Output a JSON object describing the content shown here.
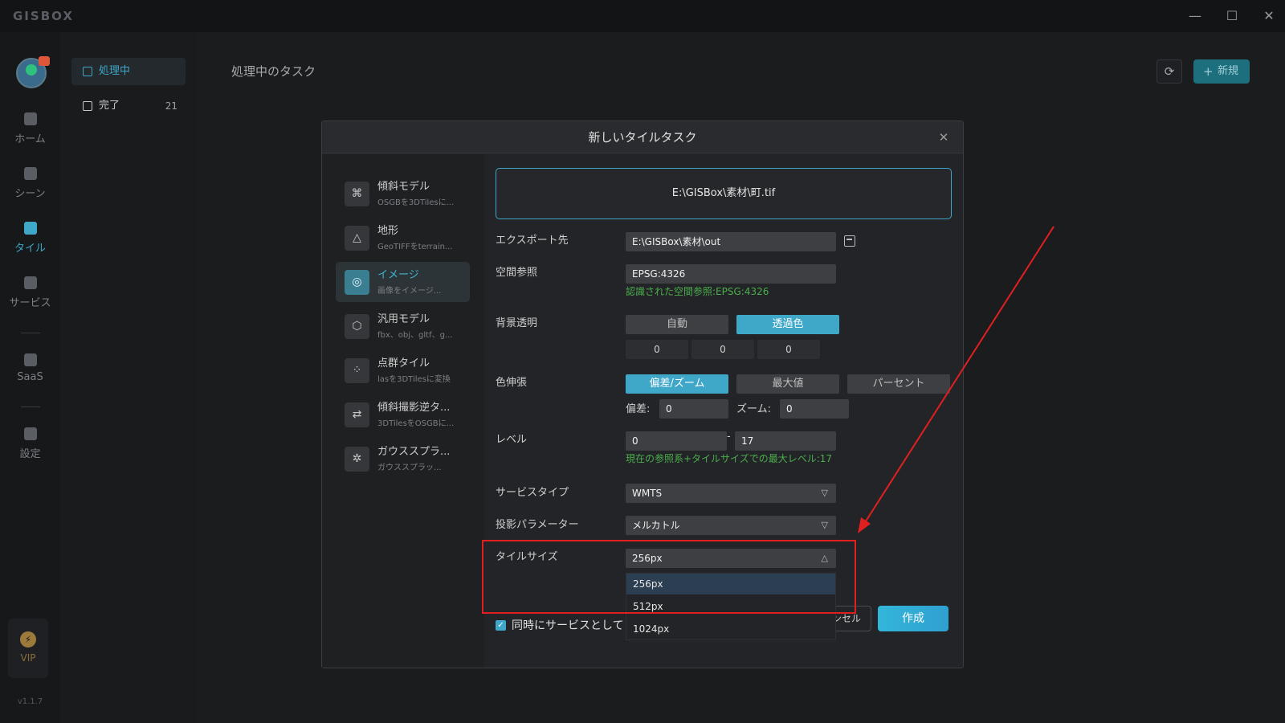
{
  "app": {
    "logo": "GISBOX",
    "version": "v1.1.7",
    "win_min": "—",
    "win_max": "☐",
    "win_close": "✕"
  },
  "rail": {
    "items": [
      {
        "label": "ホーム"
      },
      {
        "label": "シーン"
      },
      {
        "label": "タイル"
      },
      {
        "label": "サービス"
      },
      {
        "label": "SaaS"
      },
      {
        "label": "設定"
      }
    ],
    "vip": "VIP",
    "vip_icon": "⚡"
  },
  "sublist": {
    "items": [
      {
        "label": "処理中"
      },
      {
        "label": "完了",
        "count": "21"
      }
    ]
  },
  "main": {
    "title": "処理中のタスク",
    "refresh_icon": "⟳",
    "new_label": "新規"
  },
  "dialog": {
    "title": "新しいタイルタスク",
    "close": "✕",
    "categories": [
      {
        "name": "傾斜モデル",
        "desc": "OSGBを3DTilesに...",
        "icon": "⌘"
      },
      {
        "name": "地形",
        "desc": "GeoTIFFをterrain...",
        "icon": "△"
      },
      {
        "name": "イメージ",
        "desc": "画像をイメージ...",
        "icon": "◎"
      },
      {
        "name": "汎用モデル",
        "desc": "fbx、obj、gltf、g...",
        "icon": "⬡"
      },
      {
        "name": "点群タイル",
        "desc": "lasを3DTilesに変換",
        "icon": "⁘"
      },
      {
        "name": "傾斜撮影逆タ...",
        "desc": "3DTilesをOSGBに...",
        "icon": "⇄"
      },
      {
        "name": "ガウススプラ...",
        "desc": "ガウススプラッ...",
        "icon": "✲"
      }
    ],
    "file_path": "E:\\GISBox\\素材\\町.tif",
    "export": {
      "label": "エクスポート先",
      "value": "E:\\GISBox\\素材\\out"
    },
    "srs": {
      "label": "空間参照",
      "value": "EPSG:4326",
      "hint": "認識された空間参照:EPSG:4326"
    },
    "bg": {
      "label": "背景透明",
      "opt_auto": "自動",
      "opt_color": "透過色",
      "r": "0",
      "g": "0",
      "b": "0"
    },
    "stretch": {
      "label": "色伸張",
      "opt1": "偏差/ズーム",
      "opt2": "最大値",
      "opt3": "パーセント",
      "offset_label": "偏差:",
      "offset_value": "0",
      "zoom_label": "ズーム:",
      "zoom_value": "0"
    },
    "level": {
      "label": "レベル",
      "min": "0",
      "dash": "-",
      "max": "17",
      "hint": "現在の参照系+タイルサイズでの最大レベル:17"
    },
    "service_type": {
      "label": "サービスタイプ",
      "value": "WMTS"
    },
    "projection": {
      "label": "投影パラメーター",
      "value": "メルカトル"
    },
    "tile_size": {
      "label": "タイルサイズ",
      "value": "256px",
      "options": [
        "256px",
        "512px",
        "1024px"
      ]
    },
    "publish": {
      "label": "同時にサービスとして",
      "check": "✓"
    },
    "cancel": "ンセル",
    "create": "作成"
  },
  "colors": {
    "accent": "#3fa7c8",
    "highlight": "#e02020",
    "hint": "#4cae4c"
  }
}
